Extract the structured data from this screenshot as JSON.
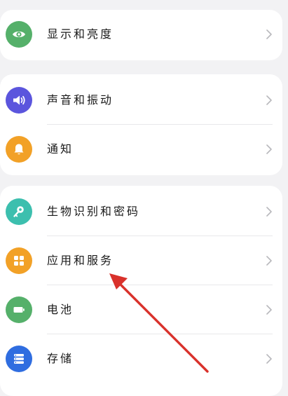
{
  "settings": {
    "group1": [
      {
        "label": "显示和亮度",
        "icon": "eye-icon",
        "color": "#55b06a"
      }
    ],
    "group2": [
      {
        "label": "声音和振动",
        "icon": "speaker-icon",
        "color": "#5b55dd"
      },
      {
        "label": "通知",
        "icon": "bell-icon",
        "color": "#f2a127"
      }
    ],
    "group3": [
      {
        "label": "生物识别和密码",
        "icon": "key-icon",
        "color": "#3cbfae"
      },
      {
        "label": "应用和服务",
        "icon": "apps-grid-icon",
        "color": "#f2a127"
      },
      {
        "label": "电池",
        "icon": "battery-icon",
        "color": "#55b06a"
      },
      {
        "label": "存储",
        "icon": "storage-icon",
        "color": "#2f6de0"
      }
    ]
  },
  "annotation": {
    "arrow_color": "#d9312b"
  }
}
